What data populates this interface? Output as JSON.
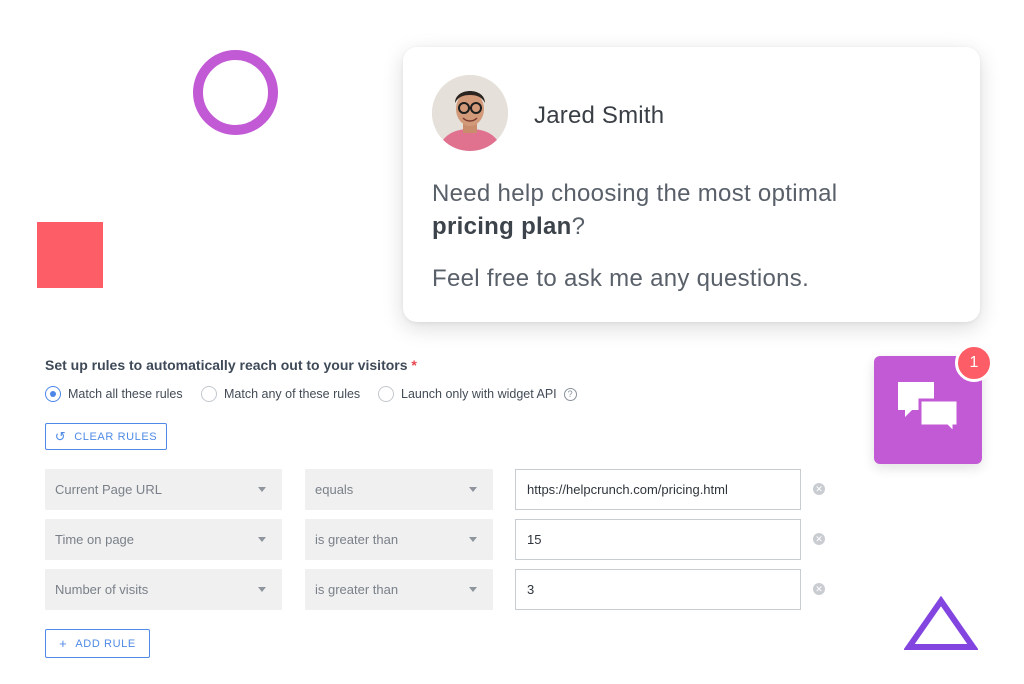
{
  "chat_popup": {
    "agent_name": "Jared Smith",
    "message_line1": "Need help choosing the most optimal",
    "message_bold": "pricing plan",
    "message_after_bold": "?",
    "message_line3": "Feel free to ask me any questions."
  },
  "launcher": {
    "icon": "chat-bubbles-icon",
    "badge_count": "1"
  },
  "rules": {
    "heading": "Set up rules to automatically reach out to your visitors",
    "required_mark": "*",
    "match_options": [
      {
        "label": "Match all these rules",
        "checked": true
      },
      {
        "label": "Match any of these rules",
        "checked": false
      },
      {
        "label": "Launch only with widget API",
        "checked": false
      }
    ],
    "help_icon": "?",
    "clear_rules_label": "CLEAR RULES",
    "add_rule_label": "ADD RULE",
    "rows": [
      {
        "field": "Current Page URL",
        "operator": "equals",
        "value": "https://helpcrunch.com/pricing.html"
      },
      {
        "field": "Time on page",
        "operator": "is greater than",
        "value": "15"
      },
      {
        "field": "Number of visits",
        "operator": "is greater than",
        "value": "3"
      }
    ]
  },
  "colors": {
    "accent_purple": "#c25ad6",
    "accent_coral": "#fd5d66",
    "link_blue": "#4f8ae6"
  }
}
